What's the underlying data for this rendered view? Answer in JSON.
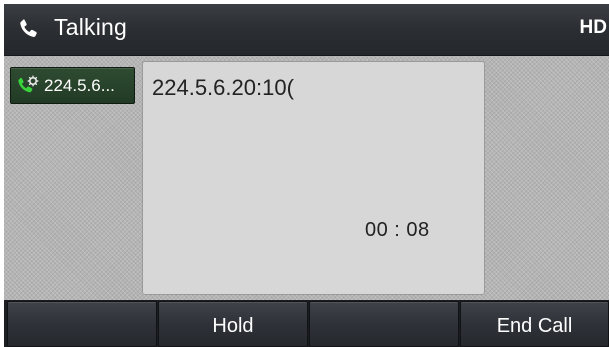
{
  "statusbar": {
    "icon": "phone-handset-icon",
    "title": "Talking",
    "hd_label": "HD"
  },
  "line": {
    "icon": "active-call-icon",
    "label": "224.5.6...",
    "icon_color": "#3bd33b"
  },
  "call": {
    "number": "224.5.6.20:10(",
    "duration": "00 : 08"
  },
  "softkeys": [
    {
      "label": ""
    },
    {
      "label": "Hold"
    },
    {
      "label": ""
    },
    {
      "label": "End Call"
    }
  ]
}
